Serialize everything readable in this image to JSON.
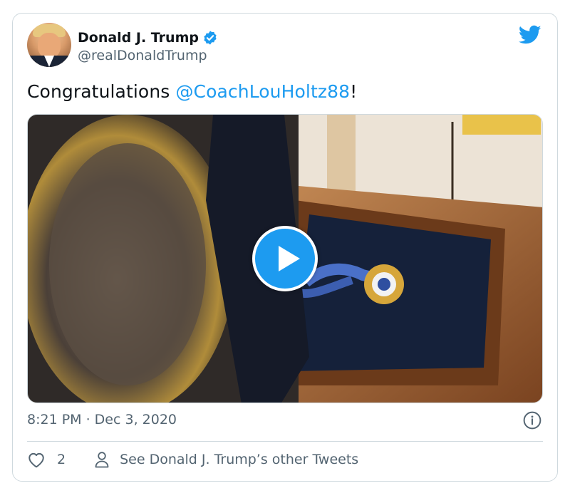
{
  "author": {
    "display_name": "Donald J. Trump",
    "handle": "@realDonaldTrump",
    "verified": true
  },
  "tweet": {
    "text_prefix": "Congratulations ",
    "mention": "@CoachLouHoltz88",
    "text_suffix": "!"
  },
  "media": {
    "type": "video"
  },
  "meta": {
    "timestamp": "8:21 PM · Dec 3, 2020"
  },
  "actions": {
    "like_count": "2",
    "other_tweets_label": "See Donald J. Trump’s other Tweets"
  },
  "icons": {
    "logo": "twitter-bird-icon",
    "verified": "verified-badge-icon",
    "play": "play-icon",
    "info": "info-icon",
    "like": "heart-icon",
    "profile": "person-icon"
  },
  "colors": {
    "accent": "#1d9bf0",
    "text": "#0f1419",
    "secondary_text": "#536471",
    "border": "#cfd9de"
  }
}
